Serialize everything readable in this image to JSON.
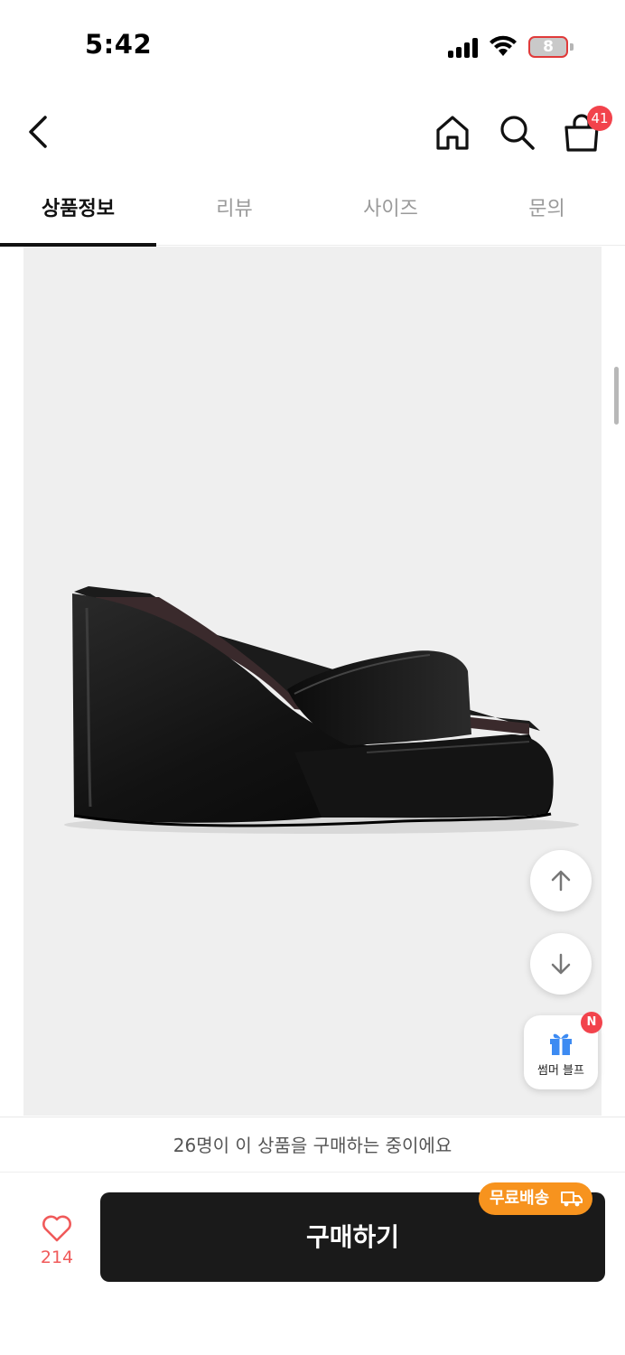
{
  "status_bar": {
    "time": "5:42",
    "battery_level": "8"
  },
  "header": {
    "icons": [
      "back-arrow-icon",
      "home-icon",
      "search-icon",
      "shopping-bag-icon"
    ],
    "cart_badge": "41"
  },
  "tabs": [
    {
      "label": "상품정보",
      "active": true
    },
    {
      "label": "리뷰",
      "active": false
    },
    {
      "label": "사이즈",
      "active": false
    },
    {
      "label": "문의",
      "active": false
    }
  ],
  "floating": {
    "up_icon": "arrow-up-icon",
    "down_icon": "arrow-down-icon",
    "event_label": "썸머 블프",
    "event_badge": "N"
  },
  "purchase": {
    "buyers_notice": "26명이 이 상품을 구매하는 중이에요",
    "like_count": "214",
    "buy_label": "구매하기",
    "free_shipping_label": "무료배송"
  },
  "colors": {
    "accent": "#f2434c",
    "shipping_badge": "#f7931e",
    "buy_button": "#1a1a1a",
    "like": "#f05a5a"
  }
}
